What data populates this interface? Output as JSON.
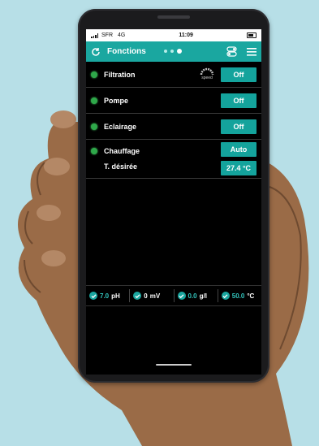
{
  "statusbar": {
    "carrier": "SFR",
    "network": "4G",
    "time": "11:09"
  },
  "appbar": {
    "title": "Fonctions",
    "page_dots": 3,
    "active_dot": 3
  },
  "controls": [
    {
      "label": "Filtration",
      "button": "Off",
      "extra_icon_label": "speed"
    },
    {
      "label": "Pompe",
      "button": "Off"
    },
    {
      "label": "Eclairage",
      "button": "Off"
    },
    {
      "label": "Chauffage",
      "button": "Auto"
    }
  ],
  "setpoint": {
    "label": "T. désirée",
    "value": "27.4 °C"
  },
  "sensors": [
    {
      "value": "7.0",
      "unit": "pH"
    },
    {
      "value": "0",
      "unit": "mV"
    },
    {
      "value": "0.0",
      "unit": "g/l"
    },
    {
      "value": "50.0",
      "unit": "°C"
    }
  ],
  "colors": {
    "accent": "#1aa7a0",
    "led_on": "#2fa84a",
    "background": "#b7dfe7"
  }
}
